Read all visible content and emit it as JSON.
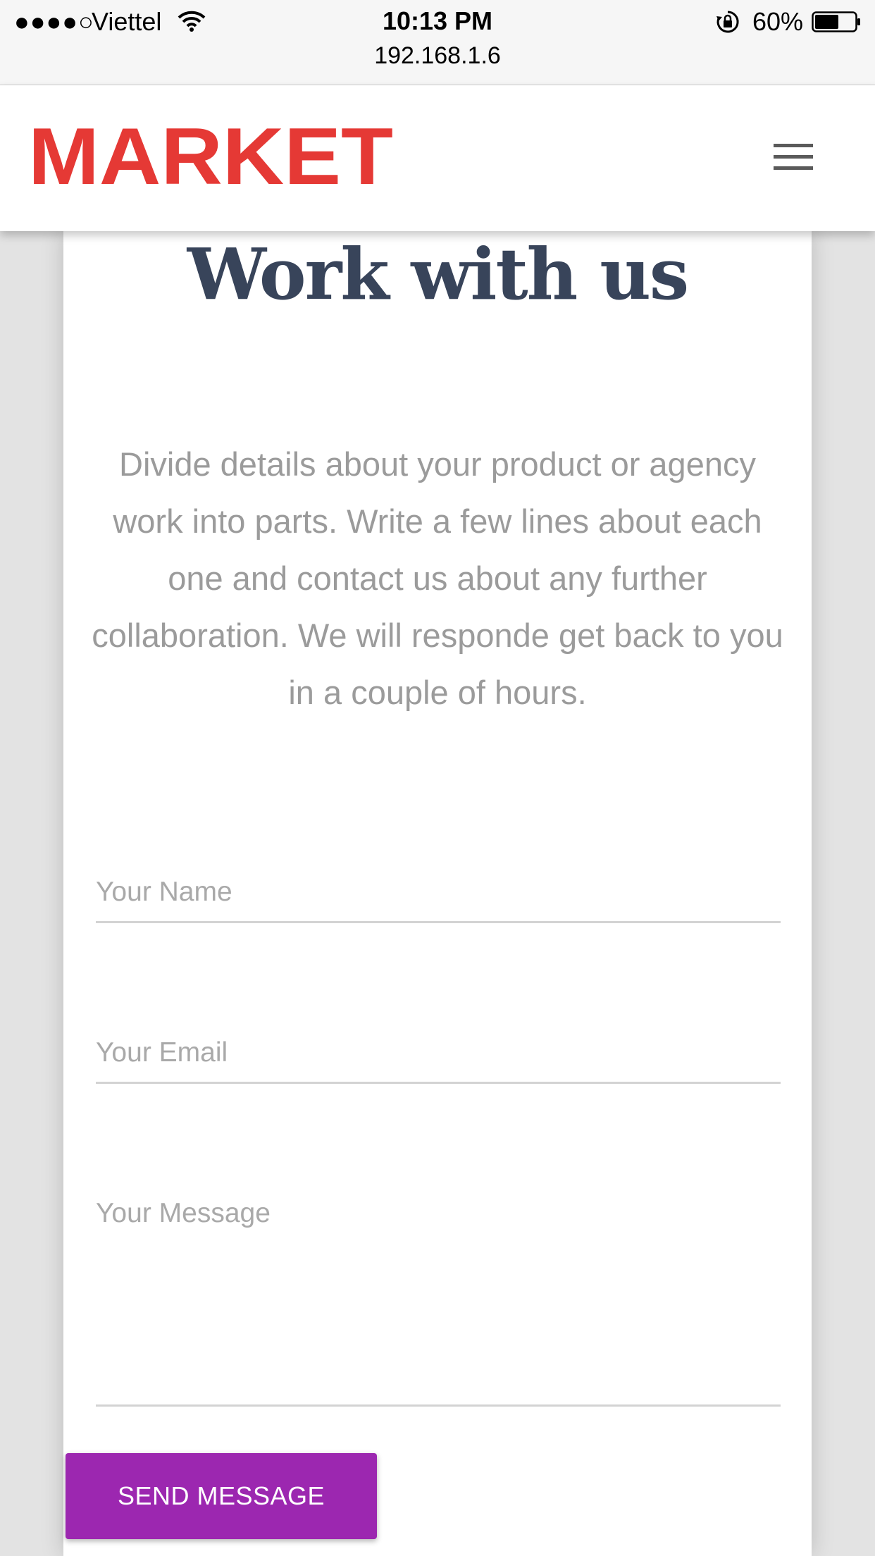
{
  "status_bar": {
    "signal": "●●●●○",
    "carrier": "Viettel",
    "wifi_icon": "wifi-icon",
    "time": "10:13 PM",
    "url": "192.168.1.6",
    "lock_icon": "rotation-lock-icon",
    "battery_percent": "60%",
    "battery_level": 0.6
  },
  "header": {
    "logo_text": "MARKET",
    "logo_color": "#e53935",
    "menu_icon": "hamburger-menu-icon"
  },
  "main": {
    "title": "Work with us",
    "intro": "Divide details about your product or agency work into parts. Write a few lines about each one and contact us about any further collaboration. We will responde get back to you in a couple of hours."
  },
  "form": {
    "name_placeholder": "Your Name",
    "email_placeholder": "Your Email",
    "message_placeholder": "Your Message",
    "submit_label": "SEND MESSAGE",
    "submit_color": "#9c27b0"
  },
  "colors": {
    "title": "#38445a",
    "body_text": "#9b9b9b"
  }
}
